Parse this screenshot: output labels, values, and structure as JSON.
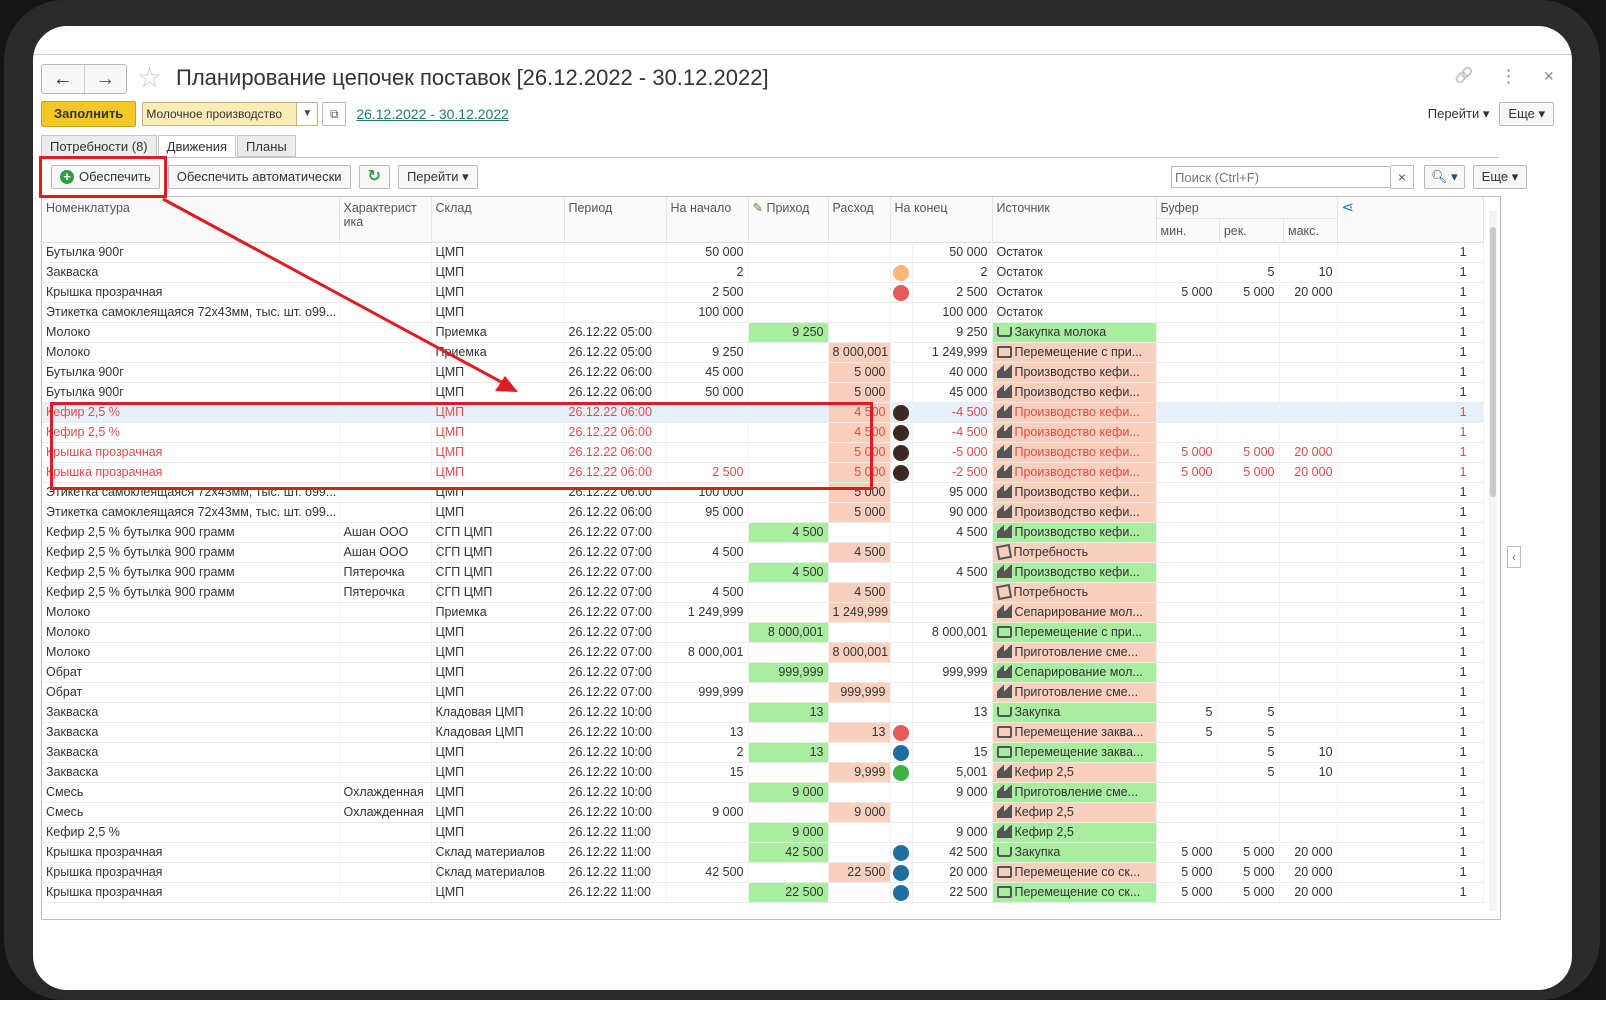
{
  "window": {
    "title": "Планирование цепочек поставок [26.12.2022 - 30.12.2022]",
    "back_icon": "←",
    "forward_icon": "→",
    "star_icon": "☆",
    "link_icon": "🔗",
    "menu_icon": "⋮",
    "close_icon": "×"
  },
  "toolbar": {
    "fill_label": "Заполнить",
    "production_value": "Молочное производство",
    "period_link": "26.12.2022 - 30.12.2022",
    "goto_label": "Перейти",
    "more_label": "Еще"
  },
  "tabs": [
    "Потребности (8)",
    "Движения",
    "Планы"
  ],
  "grid_toolbar": {
    "provide_label": "Обеспечить",
    "provide_auto_label": "Обеспечить автоматически",
    "goto_label": "Перейти",
    "search_placeholder": "Поиск (Ctrl+F)",
    "more_label": "Еще"
  },
  "columns": {
    "nomenclature": "Номенклатура",
    "characteristic": "Характерист ика",
    "warehouse": "Склад",
    "period": "Период",
    "start": "На начало",
    "income": "Приход",
    "expense": "Расход",
    "end": "На конец",
    "source": "Источник",
    "buffer": "Буфер",
    "buf_min": "мин.",
    "buf_rec": "рек.",
    "buf_max": "макс."
  },
  "colors": {
    "green_cell": "#a9eea0",
    "salmon_cell": "#f9cfbe",
    "highlight_red": "#e11b22",
    "dot_orange": "#f9b77a",
    "dot_red": "#e55a5a",
    "dot_dark": "#3b2a24",
    "dot_blue": "#1f6ea3",
    "dot_green": "#3cb043"
  },
  "rows": [
    {
      "name": "Бутылка 900г",
      "char": "",
      "wh": "ЦМП",
      "period": "",
      "start": "50 000",
      "in": "",
      "out": "",
      "dot": "",
      "end": "50 000",
      "source": "Остаток",
      "icon": "",
      "src_bg": "",
      "bmin": "",
      "brec": "",
      "bmax": "",
      "q": "1"
    },
    {
      "name": "Закваска",
      "char": "",
      "wh": "ЦМП",
      "period": "",
      "start": "2",
      "in": "",
      "out": "",
      "dot": "orange",
      "end": "2",
      "source": "Остаток",
      "icon": "",
      "src_bg": "",
      "bmin": "",
      "brec": "5",
      "bmax": "10",
      "q": "1"
    },
    {
      "name": "Крышка прозрачная",
      "char": "",
      "wh": "ЦМП",
      "period": "",
      "start": "2 500",
      "in": "",
      "out": "",
      "dot": "red",
      "end": "2 500",
      "source": "Остаток",
      "icon": "",
      "src_bg": "",
      "bmin": "5 000",
      "brec": "5 000",
      "bmax": "20 000",
      "q": "1"
    },
    {
      "name": "Этикетка самоклеящаяся 72х43мм, тыс. шт.  о99...",
      "char": "",
      "wh": "ЦМП",
      "period": "",
      "start": "100 000",
      "in": "",
      "out": "",
      "dot": "",
      "end": "100 000",
      "source": "Остаток",
      "icon": "",
      "src_bg": "",
      "bmin": "",
      "brec": "",
      "bmax": "",
      "q": "1"
    },
    {
      "name": "Молоко",
      "char": "",
      "wh": "Приемка",
      "period": "26.12.22 05:00",
      "start": "",
      "in": "9 250",
      "out": "",
      "dot": "",
      "end": "9 250",
      "source": "Закупка молока",
      "icon": "cart",
      "src_bg": "green",
      "bmin": "",
      "brec": "",
      "bmax": "",
      "q": "1"
    },
    {
      "name": "Молоко",
      "char": "",
      "wh": "Приемка",
      "period": "26.12.22 05:00",
      "start": "9 250",
      "in": "",
      "out": "8 000,001",
      "dot": "",
      "end": "1 249,999",
      "source": "Перемещение с при...",
      "icon": "truck",
      "src_bg": "salmon",
      "bmin": "",
      "brec": "",
      "bmax": "",
      "q": "1"
    },
    {
      "name": "Бутылка 900г",
      "char": "",
      "wh": "ЦМП",
      "period": "26.12.22 06:00",
      "start": "45 000",
      "in": "",
      "out": "5 000",
      "dot": "",
      "end": "40 000",
      "source": "Производство кефи...",
      "icon": "factory",
      "src_bg": "salmon",
      "bmin": "",
      "brec": "",
      "bmax": "",
      "q": "1"
    },
    {
      "name": "Бутылка 900г",
      "char": "",
      "wh": "ЦМП",
      "period": "26.12.22 06:00",
      "start": "50 000",
      "in": "",
      "out": "5 000",
      "dot": "",
      "end": "45 000",
      "source": "Производство кефи...",
      "icon": "factory",
      "src_bg": "salmon",
      "bmin": "",
      "brec": "",
      "bmax": "",
      "q": "1"
    },
    {
      "name": "Кефир 2,5 %",
      "char": "",
      "wh": "ЦМП",
      "period": "26.12.22 06:00",
      "start": "",
      "in": "",
      "out": "4 500",
      "dot": "dark",
      "end": "-4 500",
      "source": "Производство кефи...",
      "icon": "factory",
      "src_bg": "salmon",
      "bmin": "",
      "brec": "",
      "bmax": "",
      "q": "1",
      "style": "red sel"
    },
    {
      "name": "Кефир 2,5 %",
      "char": "",
      "wh": "ЦМП",
      "period": "26.12.22 06:00",
      "start": "",
      "in": "",
      "out": "4 500",
      "dot": "dark",
      "end": "-4 500",
      "source": "Производство кефи...",
      "icon": "factory",
      "src_bg": "salmon",
      "bmin": "",
      "brec": "",
      "bmax": "",
      "q": "1",
      "style": "red"
    },
    {
      "name": "Крышка прозрачная",
      "char": "",
      "wh": "ЦМП",
      "period": "26.12.22 06:00",
      "start": "",
      "in": "",
      "out": "5 000",
      "dot": "dark",
      "end": "-5 000",
      "source": "Производство кефи...",
      "icon": "factory",
      "src_bg": "salmon",
      "bmin": "5 000",
      "brec": "5 000",
      "bmax": "20 000",
      "q": "1",
      "style": "red"
    },
    {
      "name": "Крышка прозрачная",
      "char": "",
      "wh": "ЦМП",
      "period": "26.12.22 06:00",
      "start": "2 500",
      "in": "",
      "out": "5 000",
      "dot": "dark",
      "end": "-2 500",
      "source": "Производство кефи...",
      "icon": "factory",
      "src_bg": "salmon",
      "bmin": "5 000",
      "brec": "5 000",
      "bmax": "20 000",
      "q": "1",
      "style": "red"
    },
    {
      "name": "Этикетка самоклеящаяся 72х43мм, тыс. шт.  о99...",
      "char": "",
      "wh": "ЦМП",
      "period": "26.12.22 06:00",
      "start": "100 000",
      "in": "",
      "out": "5 000",
      "dot": "",
      "end": "95 000",
      "source": "Производство кефи...",
      "icon": "factory",
      "src_bg": "salmon",
      "bmin": "",
      "brec": "",
      "bmax": "",
      "q": "1"
    },
    {
      "name": "Этикетка самоклеящаяся 72х43мм, тыс. шт.  о99...",
      "char": "",
      "wh": "ЦМП",
      "period": "26.12.22 06:00",
      "start": "95 000",
      "in": "",
      "out": "5 000",
      "dot": "",
      "end": "90 000",
      "source": "Производство кефи...",
      "icon": "factory",
      "src_bg": "salmon",
      "bmin": "",
      "brec": "",
      "bmax": "",
      "q": "1"
    },
    {
      "name": "Кефир 2,5 % бутылка 900 грамм",
      "char": "Ашан ООО",
      "wh": "СГП ЦМП",
      "period": "26.12.22 07:00",
      "start": "",
      "in": "4 500",
      "out": "",
      "dot": "",
      "end": "4 500",
      "source": "Производство кефи...",
      "icon": "factory",
      "src_bg": "green",
      "bmin": "",
      "brec": "",
      "bmax": "",
      "q": "1"
    },
    {
      "name": "Кефир 2,5 % бутылка 900 грамм",
      "char": "Ашан ООО",
      "wh": "СГП ЦМП",
      "period": "26.12.22 07:00",
      "start": "4 500",
      "in": "",
      "out": "4 500",
      "dot": "",
      "end": "",
      "source": "Потребность",
      "icon": "need",
      "src_bg": "salmon",
      "bmin": "",
      "brec": "",
      "bmax": "",
      "q": "1"
    },
    {
      "name": "Кефир 2,5 % бутылка 900 грамм",
      "char": "Пятерочка",
      "wh": "СГП ЦМП",
      "period": "26.12.22 07:00",
      "start": "",
      "in": "4 500",
      "out": "",
      "dot": "",
      "end": "4 500",
      "source": "Производство кефи...",
      "icon": "factory",
      "src_bg": "green",
      "bmin": "",
      "brec": "",
      "bmax": "",
      "q": "1"
    },
    {
      "name": "Кефир 2,5 % бутылка 900 грамм",
      "char": "Пятерочка",
      "wh": "СГП ЦМП",
      "period": "26.12.22 07:00",
      "start": "4 500",
      "in": "",
      "out": "4 500",
      "dot": "",
      "end": "",
      "source": "Потребность",
      "icon": "need",
      "src_bg": "salmon",
      "bmin": "",
      "brec": "",
      "bmax": "",
      "q": "1"
    },
    {
      "name": "Молоко",
      "char": "",
      "wh": "Приемка",
      "period": "26.12.22 07:00",
      "start": "1 249,999",
      "in": "",
      "out": "1 249,999",
      "dot": "",
      "end": "",
      "source": "Сепарирование мол...",
      "icon": "factory",
      "src_bg": "salmon",
      "bmin": "",
      "brec": "",
      "bmax": "",
      "q": "1"
    },
    {
      "name": "Молоко",
      "char": "",
      "wh": "ЦМП",
      "period": "26.12.22 07:00",
      "start": "",
      "in": "8 000,001",
      "out": "",
      "dot": "",
      "end": "8 000,001",
      "source": "Перемещение с при...",
      "icon": "truck",
      "src_bg": "green",
      "bmin": "",
      "brec": "",
      "bmax": "",
      "q": "1"
    },
    {
      "name": "Молоко",
      "char": "",
      "wh": "ЦМП",
      "period": "26.12.22 07:00",
      "start": "8 000,001",
      "in": "",
      "out": "8 000,001",
      "dot": "",
      "end": "",
      "source": "Приготовление сме...",
      "icon": "factory",
      "src_bg": "salmon",
      "bmin": "",
      "brec": "",
      "bmax": "",
      "q": "1"
    },
    {
      "name": "Обрат",
      "char": "",
      "wh": "ЦМП",
      "period": "26.12.22 07:00",
      "start": "",
      "in": "999,999",
      "out": "",
      "dot": "",
      "end": "999,999",
      "source": "Сепарирование мол...",
      "icon": "factory",
      "src_bg": "green",
      "bmin": "",
      "brec": "",
      "bmax": "",
      "q": "1"
    },
    {
      "name": "Обрат",
      "char": "",
      "wh": "ЦМП",
      "period": "26.12.22 07:00",
      "start": "999,999",
      "in": "",
      "out": "999,999",
      "dot": "",
      "end": "",
      "source": "Приготовление сме...",
      "icon": "factory",
      "src_bg": "salmon",
      "bmin": "",
      "brec": "",
      "bmax": "",
      "q": "1"
    },
    {
      "name": "Закваска",
      "char": "",
      "wh": "Кладовая ЦМП",
      "period": "26.12.22 10:00",
      "start": "",
      "in": "13",
      "out": "",
      "dot": "",
      "end": "13",
      "source": "Закупка",
      "icon": "cart",
      "src_bg": "green",
      "bmin": "5",
      "brec": "5",
      "bmax": "",
      "q": "1"
    },
    {
      "name": "Закваска",
      "char": "",
      "wh": "Кладовая ЦМП",
      "period": "26.12.22 10:00",
      "start": "13",
      "in": "",
      "out": "13",
      "dot": "red",
      "end": "",
      "source": "Перемещение заква...",
      "icon": "truck",
      "src_bg": "salmon",
      "bmin": "5",
      "brec": "5",
      "bmax": "",
      "q": "1"
    },
    {
      "name": "Закваска",
      "char": "",
      "wh": "ЦМП",
      "period": "26.12.22 10:00",
      "start": "2",
      "in": "13",
      "out": "",
      "dot": "blue",
      "end": "15",
      "source": "Перемещение заква...",
      "icon": "truck",
      "src_bg": "green",
      "bmin": "",
      "brec": "5",
      "bmax": "10",
      "q": "1"
    },
    {
      "name": "Закваска",
      "char": "",
      "wh": "ЦМП",
      "period": "26.12.22 10:00",
      "start": "15",
      "in": "",
      "out": "9,999",
      "dot": "green",
      "end": "5,001",
      "source": "Кефир 2,5",
      "icon": "factory",
      "src_bg": "salmon",
      "bmin": "",
      "brec": "5",
      "bmax": "10",
      "q": "1"
    },
    {
      "name": "Смесь",
      "char": "Охлажденная",
      "wh": "ЦМП",
      "period": "26.12.22 10:00",
      "start": "",
      "in": "9 000",
      "out": "",
      "dot": "",
      "end": "9 000",
      "source": "Приготовление сме...",
      "icon": "factory",
      "src_bg": "green",
      "bmin": "",
      "brec": "",
      "bmax": "",
      "q": "1"
    },
    {
      "name": "Смесь",
      "char": "Охлажденная",
      "wh": "ЦМП",
      "period": "26.12.22 10:00",
      "start": "9 000",
      "in": "",
      "out": "9 000",
      "dot": "",
      "end": "",
      "source": "Кефир 2,5",
      "icon": "factory",
      "src_bg": "salmon",
      "bmin": "",
      "brec": "",
      "bmax": "",
      "q": "1"
    },
    {
      "name": "Кефир 2,5 %",
      "char": "",
      "wh": "ЦМП",
      "period": "26.12.22 11:00",
      "start": "",
      "in": "9 000",
      "out": "",
      "dot": "",
      "end": "9 000",
      "source": "Кефир 2,5",
      "icon": "factory",
      "src_bg": "green",
      "bmin": "",
      "brec": "",
      "bmax": "",
      "q": "1"
    },
    {
      "name": "Крышка прозрачная",
      "char": "",
      "wh": "Склад материалов",
      "period": "26.12.22 11:00",
      "start": "",
      "in": "42 500",
      "out": "",
      "dot": "blue",
      "end": "42 500",
      "source": "Закупка",
      "icon": "cart",
      "src_bg": "green",
      "bmin": "5 000",
      "brec": "5 000",
      "bmax": "20 000",
      "q": "1"
    },
    {
      "name": "Крышка прозрачная",
      "char": "",
      "wh": "Склад материалов",
      "period": "26.12.22 11:00",
      "start": "42 500",
      "in": "",
      "out": "22 500",
      "dot": "blue",
      "end": "20 000",
      "source": "Перемещение со ск...",
      "icon": "truck",
      "src_bg": "salmon",
      "bmin": "5 000",
      "brec": "5 000",
      "bmax": "20 000",
      "q": "1"
    },
    {
      "name": "Крышка прозрачная",
      "char": "",
      "wh": "ЦМП",
      "period": "26.12.22 11:00",
      "start": "",
      "in": "22 500",
      "out": "",
      "dot": "blue",
      "end": "22 500",
      "source": "Перемещение со ск...",
      "icon": "truck",
      "src_bg": "green",
      "bmin": "5 000",
      "brec": "5 000",
      "bmax": "20 000",
      "q": "1"
    }
  ]
}
